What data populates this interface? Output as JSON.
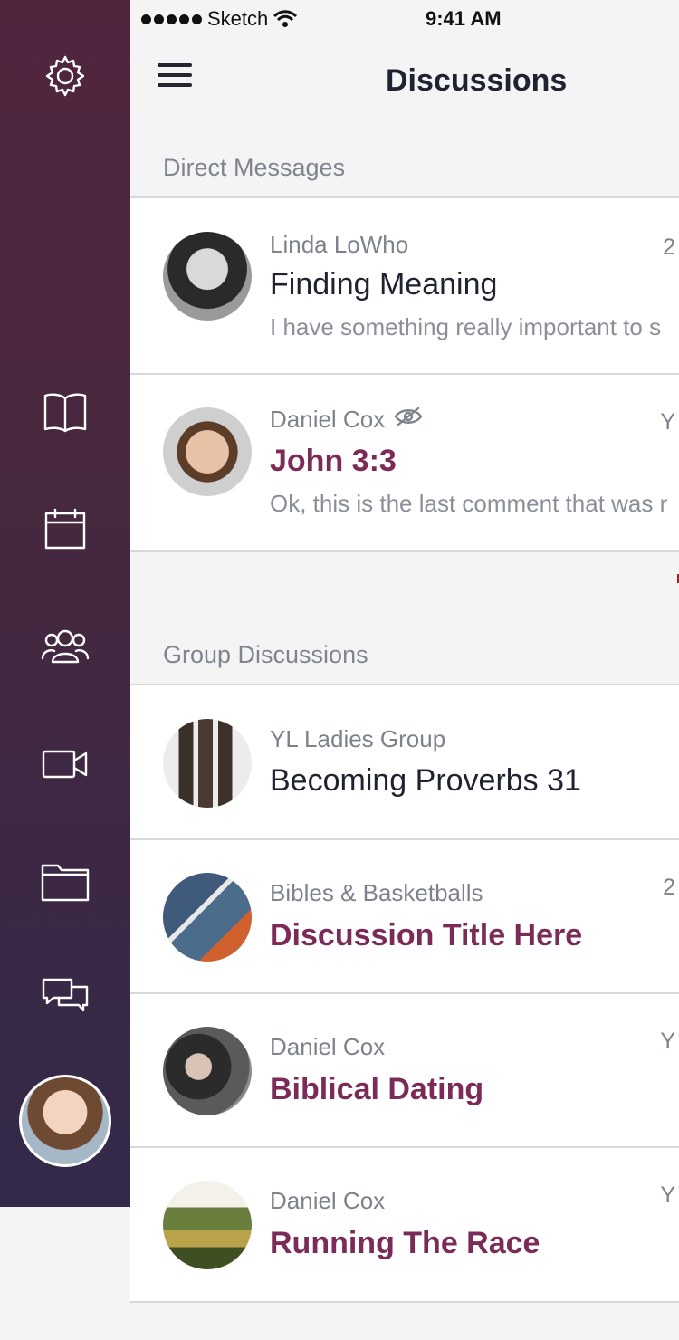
{
  "status_bar": {
    "carrier": "Sketch",
    "time": "9:41 AM"
  },
  "header": {
    "title": "Discussions"
  },
  "sidebar": {
    "items": [
      {
        "icon": "gear-icon"
      },
      {
        "icon": "book-icon"
      },
      {
        "icon": "calendar-icon"
      },
      {
        "icon": "group-icon"
      },
      {
        "icon": "video-icon"
      },
      {
        "icon": "folder-icon"
      },
      {
        "icon": "chat-icon"
      }
    ]
  },
  "direct_messages": {
    "label": "Direct Messages",
    "items": [
      {
        "sender": "Linda LoWho",
        "subject": "Finding Meaning",
        "preview": "I have something really important to s",
        "meta": "2",
        "hidden": false,
        "accent": false
      },
      {
        "sender": "Daniel Cox",
        "subject": "John 3:3",
        "preview": "Ok, this is the last comment that was r",
        "meta": "Y",
        "hidden": true,
        "accent": true
      }
    ]
  },
  "group_discussions": {
    "label": "Group Discussions",
    "items": [
      {
        "sender": "YL Ladies Group",
        "subject": "Becoming Proverbs 31",
        "meta": "",
        "accent": false
      },
      {
        "sender": "Bibles & Basketballs",
        "subject": "Discussion Title Here",
        "meta": "2",
        "accent": true
      },
      {
        "sender": "Daniel Cox",
        "subject": "Biblical Dating",
        "meta": "Y",
        "accent": true
      },
      {
        "sender": "Daniel Cox",
        "subject": "Running The Race",
        "meta": "Y",
        "accent": true
      }
    ]
  },
  "colors": {
    "accent": "#7a2b58",
    "sidebar_top": "#52253f",
    "sidebar_bottom": "#33294a"
  }
}
